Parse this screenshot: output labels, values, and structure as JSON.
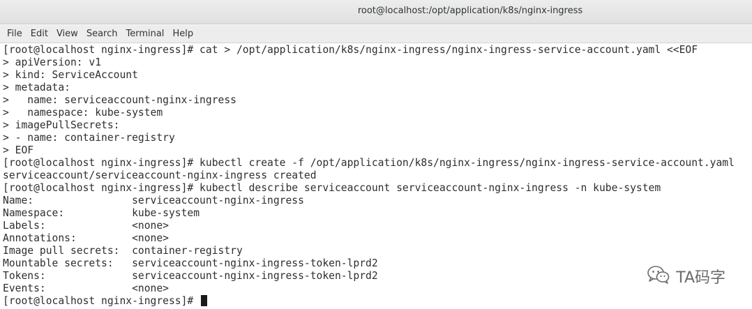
{
  "window": {
    "title": "root@localhost:/opt/application/k8s/nginx-ingress"
  },
  "menu": [
    "File",
    "Edit",
    "View",
    "Search",
    "Terminal",
    "Help"
  ],
  "terminal": {
    "lines": [
      "[root@localhost nginx-ingress]# cat > /opt/application/k8s/nginx-ingress/nginx-ingress-service-account.yaml <<EOF",
      "> apiVersion: v1",
      "> kind: ServiceAccount",
      "> metadata:",
      ">   name: serviceaccount-nginx-ingress",
      ">   namespace: kube-system",
      "> imagePullSecrets:",
      "> - name: container-registry",
      "> EOF",
      "[root@localhost nginx-ingress]# kubectl create -f /opt/application/k8s/nginx-ingress/nginx-ingress-service-account.yaml",
      "serviceaccount/serviceaccount-nginx-ingress created",
      "[root@localhost nginx-ingress]# kubectl describe serviceaccount serviceaccount-nginx-ingress -n kube-system",
      "Name:                serviceaccount-nginx-ingress",
      "Namespace:           kube-system",
      "Labels:              <none>",
      "Annotations:         <none>",
      "Image pull secrets:  container-registry",
      "Mountable secrets:   serviceaccount-nginx-ingress-token-lprd2",
      "Tokens:              serviceaccount-nginx-ingress-token-lprd2",
      "Events:              <none>"
    ],
    "prompt": "[root@localhost nginx-ingress]# "
  },
  "watermark": {
    "text": "TA码字",
    "icon": "wechat-icon"
  }
}
